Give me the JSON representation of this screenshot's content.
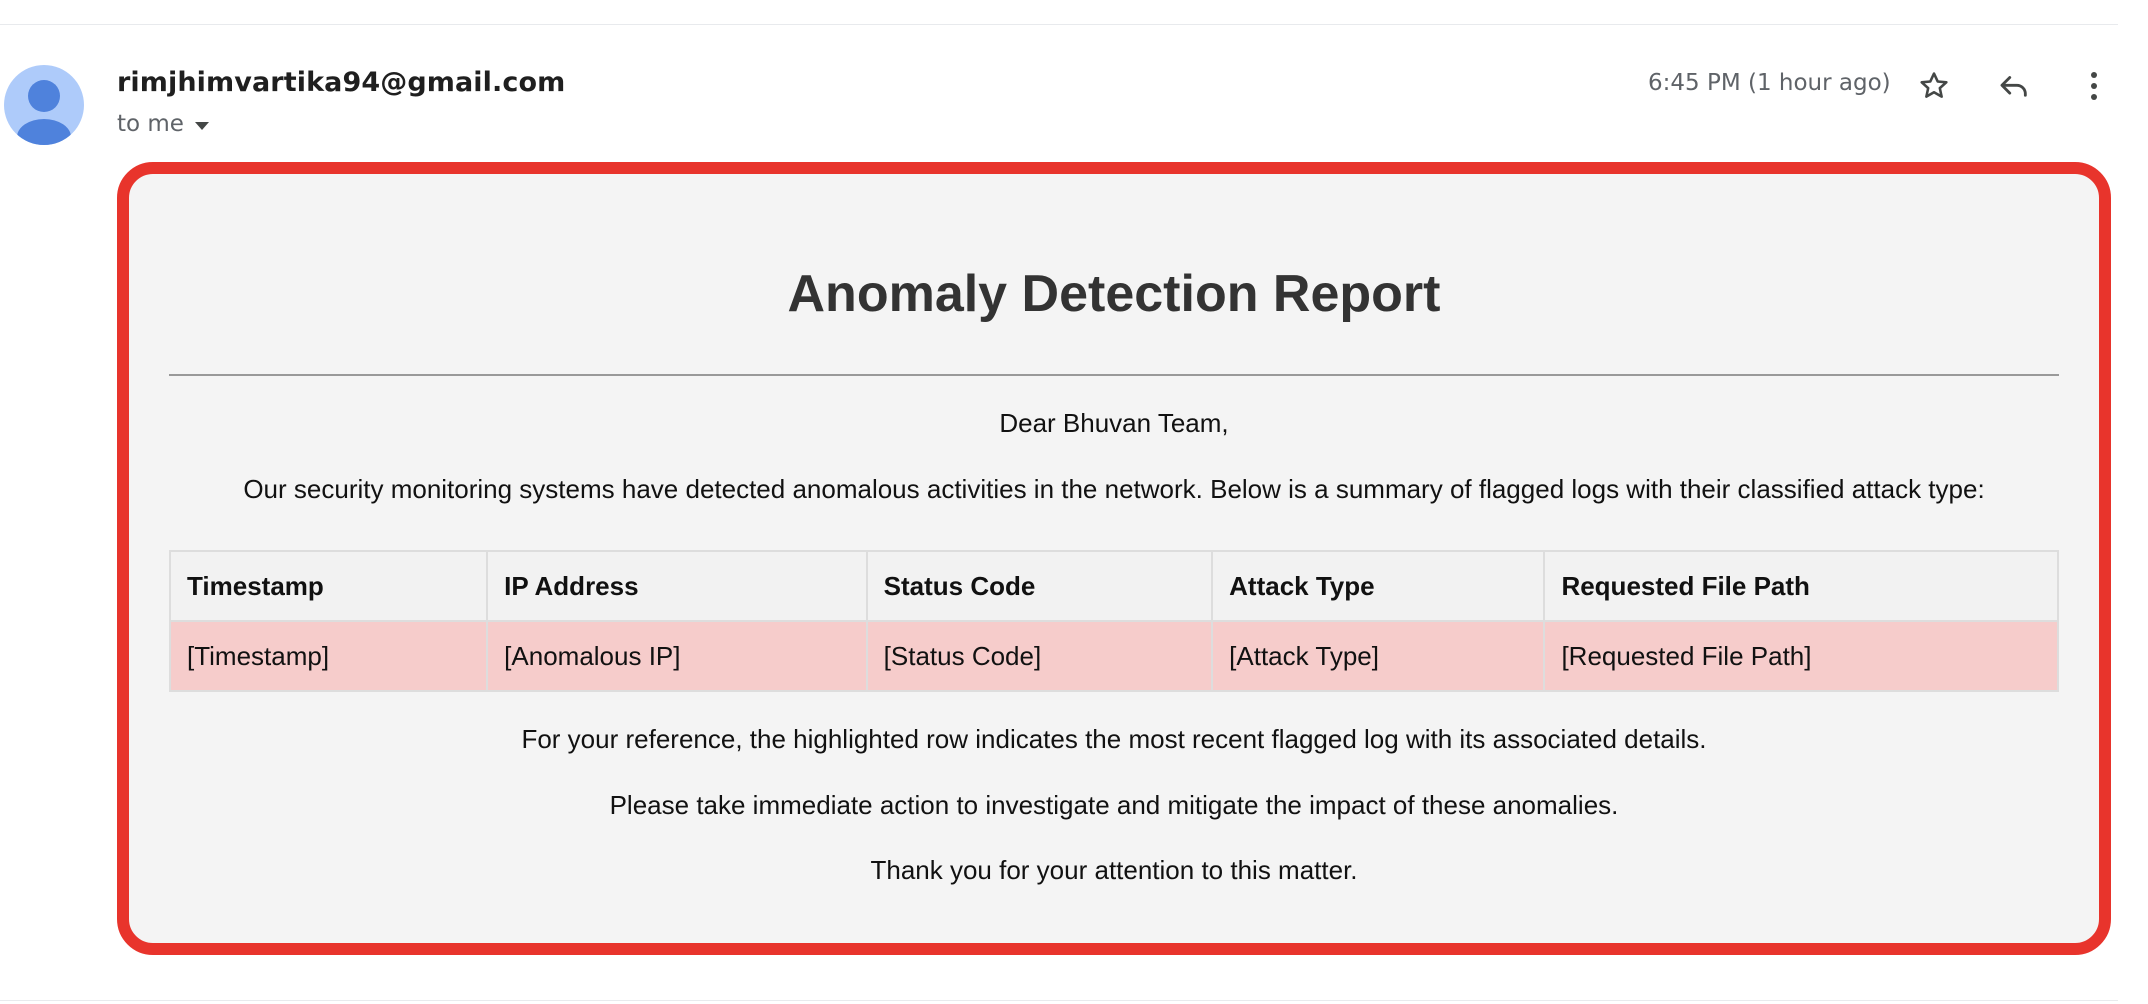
{
  "email": {
    "sender": "rimjhimvartika94@gmail.com",
    "recipient_label": "to me",
    "timestamp": "6:45 PM (1 hour ago)",
    "icons": {
      "avatar": "person-avatar-icon",
      "recipient_toggle": "caret-down-icon",
      "star": "star-outline-icon",
      "reply": "reply-icon",
      "more": "more-vertical-icon"
    }
  },
  "report": {
    "title": "Anomaly Detection Report",
    "greeting": "Dear Bhuvan Team,",
    "intro": "Our security monitoring systems have detected anomalous activities in the network. Below is a summary of flagged logs with their classified attack type:",
    "table": {
      "headers": [
        "Timestamp",
        "IP Address",
        "Status Code",
        "Attack Type",
        "Requested File Path"
      ],
      "rows": [
        [
          "[Timestamp]",
          "[Anomalous IP]",
          "[Status Code]",
          "[Attack Type]",
          "[Requested File Path]"
        ]
      ]
    },
    "reference": "For your reference, the highlighted row indicates the most recent flagged log with its associated details.",
    "action": "Please take immediate action to investigate and mitigate the impact of these anomalies.",
    "thanks": "Thank you for your attention to this matter."
  },
  "colors": {
    "frame_border": "#e8342c",
    "report_background": "#f4f4f4",
    "highlight_row": "#f6cccb",
    "header_row": "#f2f2f2",
    "avatar_bg": "#aecbfa",
    "avatar_fg": "#4f82dc"
  }
}
